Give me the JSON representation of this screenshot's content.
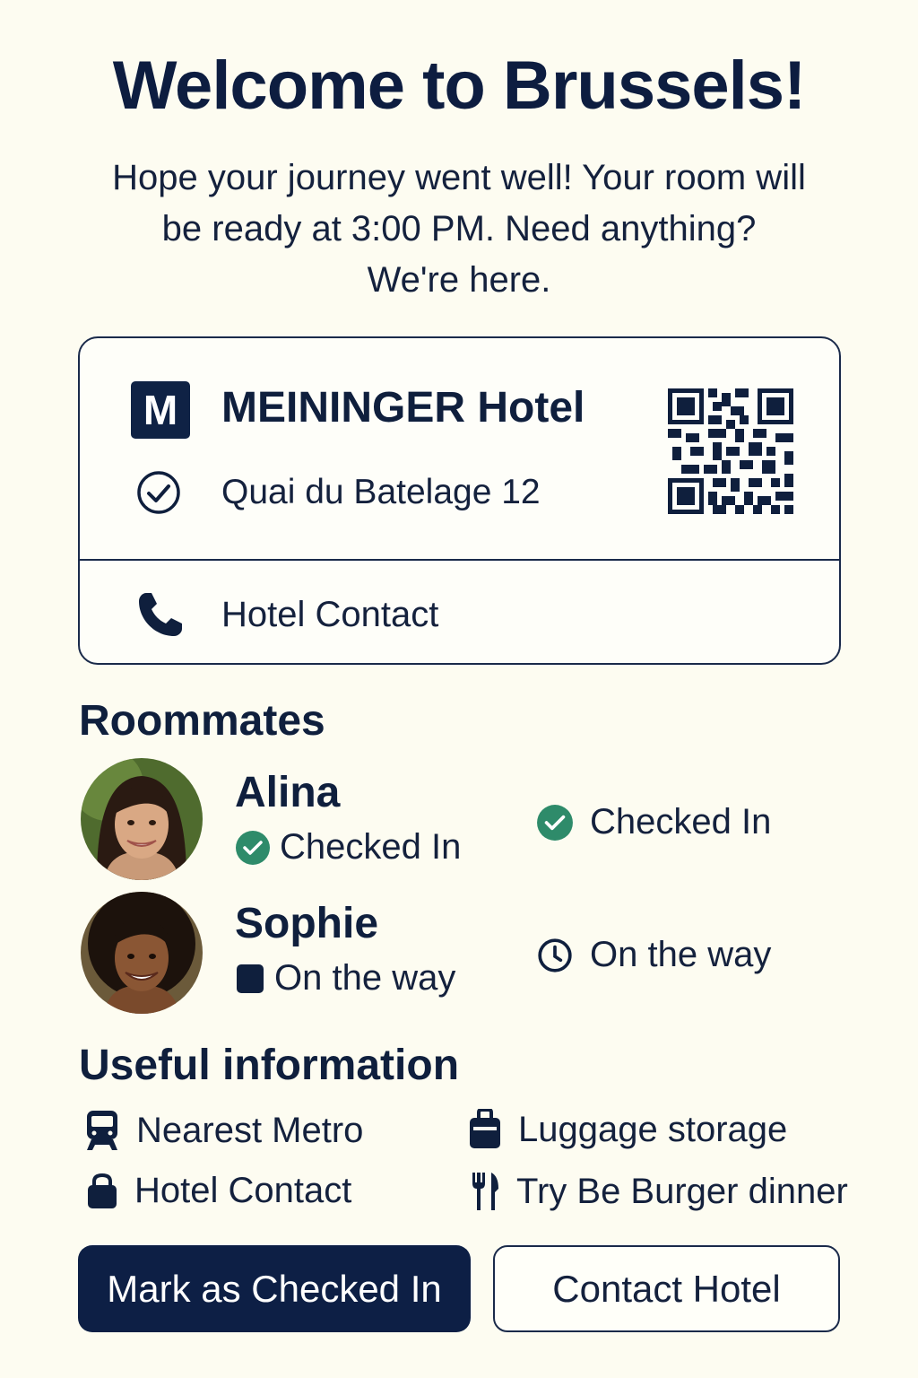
{
  "header": {
    "title": "Welcome to Brussels!",
    "intro_line1": "Hope your journey went well! Your room will",
    "intro_line2": "be ready at 3:00 PM. Need anything?",
    "intro_line3": "We're here."
  },
  "hotel": {
    "logo_letter": "M",
    "name": "MEININGER Hotel",
    "address": "Quai du Batelage 12",
    "contact_label": "Hotel Contact",
    "icons": {
      "logo": "meininger-logo-icon",
      "address": "check-circle-icon",
      "qr": "qr-code-icon",
      "contact": "phone-icon"
    }
  },
  "roommates": {
    "heading": "Roommates",
    "items": [
      {
        "name": "Alina",
        "status_inline": "Checked In",
        "status_right": "Checked In",
        "status_icon": "check-circle-icon",
        "status_color": "#2e8b6a"
      },
      {
        "name": "Sophie",
        "status_inline": "On the way",
        "status_right": "On the way",
        "status_icon": "clock-icon",
        "status_color": "#0f1f3d"
      }
    ]
  },
  "useful_info": {
    "heading": "Useful information",
    "items": [
      {
        "label": "Nearest Metro",
        "icon": "metro-icon"
      },
      {
        "label": "Luggage storage",
        "icon": "luggage-icon"
      },
      {
        "label": "Hotel Contact",
        "icon": "lock-icon"
      },
      {
        "label": "Try Be Burger dinner",
        "icon": "fork-knife-icon"
      }
    ]
  },
  "actions": {
    "primary_label": "Mark as Checked In",
    "secondary_label": "Contact Hotel"
  },
  "colors": {
    "background": "#fdfcf1",
    "navy": "#0d1f45",
    "accent_green": "#2e8b6a"
  }
}
